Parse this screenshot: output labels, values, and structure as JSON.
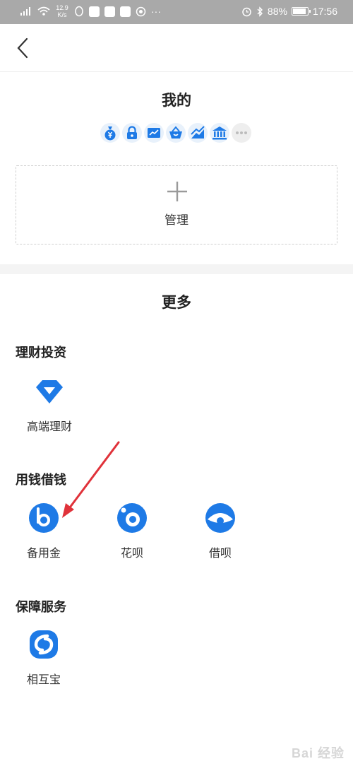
{
  "status_bar": {
    "network_speed": "12.9",
    "speed_unit": "K/s",
    "extra": "···",
    "battery": "88%",
    "battery_level": 0.88,
    "time": "17:56"
  },
  "my_section": {
    "title": "我的",
    "mini_icons": [
      "money-bag-icon",
      "lock-icon",
      "chart-card-icon",
      "basket-icon",
      "trend-icon",
      "bank-icon",
      "more-dots-icon"
    ],
    "manage_label": "管理"
  },
  "more_section": {
    "title": "更多",
    "groups": [
      {
        "title": "理财投资",
        "apps": [
          {
            "label": "高端理财",
            "icon": "diamond-icon"
          }
        ]
      },
      {
        "title": "用钱借钱",
        "apps": [
          {
            "label": "备用金",
            "icon": "reserve-fund-icon"
          },
          {
            "label": "花呗",
            "icon": "huabei-icon"
          },
          {
            "label": "借呗",
            "icon": "jiebei-icon"
          }
        ]
      },
      {
        "title": "保障服务",
        "apps": [
          {
            "label": "相互宝",
            "icon": "xianghubao-icon"
          }
        ]
      }
    ]
  },
  "watermark": "Bai 经验",
  "colors": {
    "accent": "#1e7ae6",
    "arrow": "#e0323a",
    "status_bar": "#a9a9a9"
  }
}
